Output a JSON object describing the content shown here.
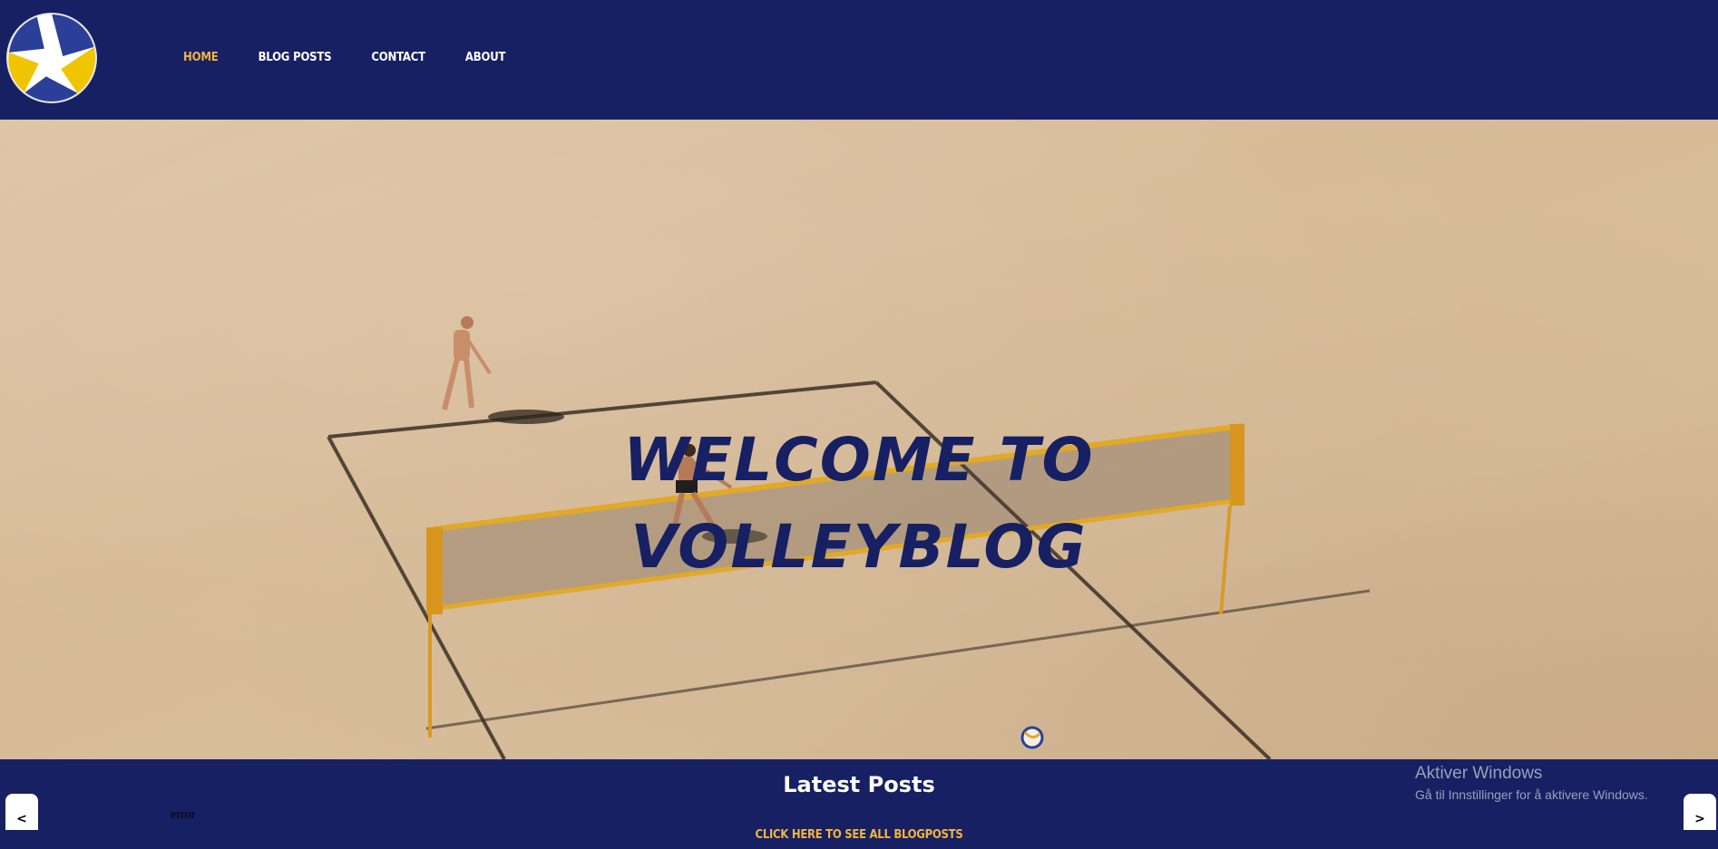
{
  "header": {
    "logo_icon": "volleyball-icon",
    "nav": [
      {
        "label": "HOME",
        "active": true
      },
      {
        "label": "BLOG POSTS",
        "active": false
      },
      {
        "label": "CONTACT",
        "active": false
      },
      {
        "label": "ABOUT",
        "active": false
      }
    ]
  },
  "hero": {
    "title_line1": "WELCOME TO",
    "title_line2": "VOLLEYBLOG",
    "image": "beach-volleyball-court-photo"
  },
  "latest": {
    "title": "Latest Posts",
    "prev_label": "<",
    "next_label": ">",
    "error_text": "error",
    "all_posts_link": "CLICK HERE TO SEE ALL BLOGPOSTS"
  },
  "watermark": {
    "title": "Aktiver Windows",
    "subtitle": "Gå til Innstillinger for å aktivere Windows."
  },
  "colors": {
    "navy": "#172063",
    "accent": "#f1b43c",
    "sand": "#d9bf9d"
  }
}
